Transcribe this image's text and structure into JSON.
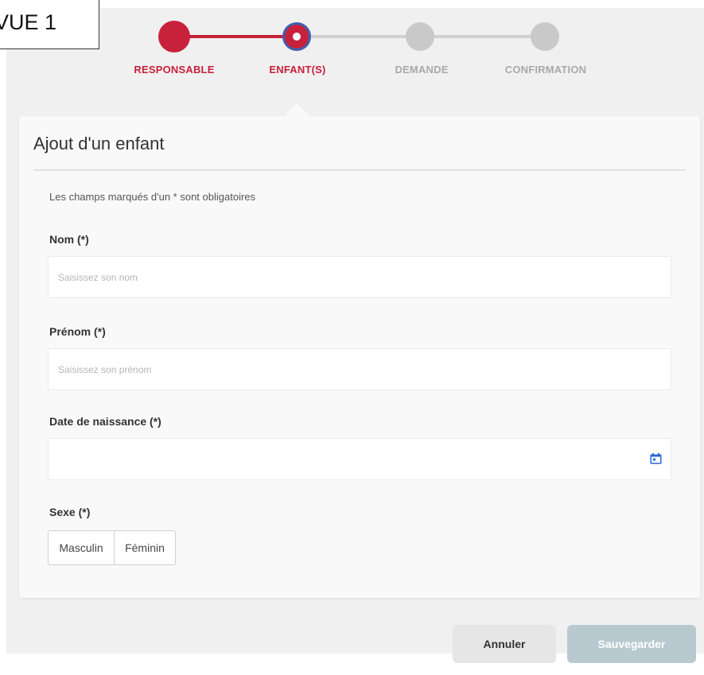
{
  "badge": {
    "label": "VUE 1"
  },
  "stepper": {
    "steps": [
      {
        "label": "RESPONSABLE",
        "state": "done"
      },
      {
        "label": "ENFANT(S)",
        "state": "current"
      },
      {
        "label": "DEMANDE",
        "state": "pending"
      },
      {
        "label": "CONFIRMATION",
        "state": "pending"
      }
    ],
    "colors": {
      "active": "#c8213b",
      "current_ring": "#3f5fb0",
      "inactive": "#c9c9c9",
      "inactive_text": "#a9a9a9"
    }
  },
  "form": {
    "title": "Ajout d'un enfant",
    "required_note": "Les champs marqués d'un * sont obligatoires",
    "nom": {
      "label": "Nom (*)",
      "placeholder": "Saisissez son nom",
      "value": ""
    },
    "prenom": {
      "label": "Prénom (*)",
      "placeholder": "Saisissez son prénom",
      "value": ""
    },
    "date_naissance": {
      "label": "Date de naissance (*)",
      "value": "",
      "icon": "calendar-icon"
    },
    "sexe": {
      "label": "Sexe (*)",
      "options": [
        "Masculin",
        "Féminin"
      ]
    }
  },
  "actions": {
    "cancel_label": "Annuler",
    "save_label": "Sauvegarder",
    "save_color": "#b9c9d0",
    "cancel_color": "#e6e6e6"
  }
}
